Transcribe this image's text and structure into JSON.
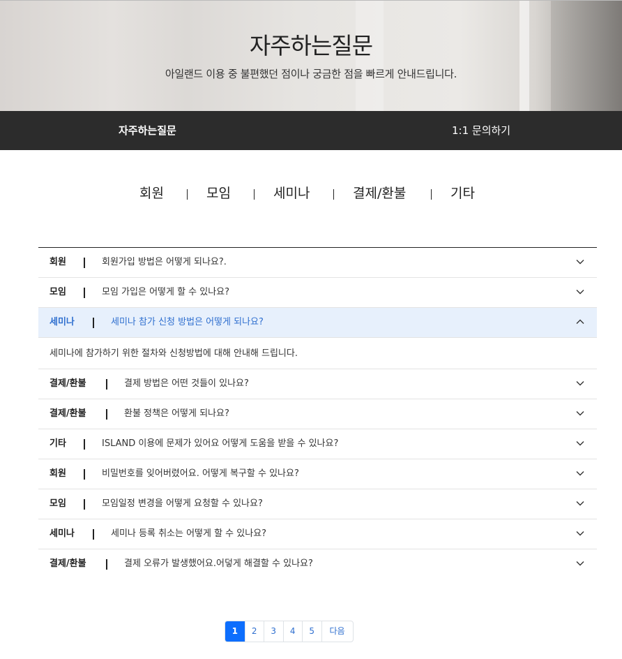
{
  "hero": {
    "title": "자주하는질문",
    "subtitle": "아일랜드 이용 중 불편했던 점이나 궁금한 점을 빠르게 안내드립니다."
  },
  "nav": {
    "tabs": [
      {
        "label": "자주하는질문",
        "active": true
      },
      {
        "label": "1:1 문의하기",
        "active": false
      }
    ]
  },
  "categories": [
    "회원",
    "모임",
    "세미나",
    "결제/환불",
    "기타"
  ],
  "faqs": [
    {
      "category": "회원",
      "question": "회원가입 방법은 어떻게 되나요?.",
      "expanded": false
    },
    {
      "category": "모임",
      "question": "모임 가입은 어떻게 할 수 있나요?",
      "expanded": false
    },
    {
      "category": "세미나",
      "question": "세미나 참가 신청 방법은 어떻게 되나요?",
      "expanded": true,
      "answer": "세미나에 참가하기 위한 절차와 신청방법에 대해 안내해 드립니다."
    },
    {
      "category": "결제/환불",
      "question": "결제 방법은 어떤 것들이 있나요?",
      "expanded": false
    },
    {
      "category": "결제/환불",
      "question": "환불 정책은 어떻게 되나요?",
      "expanded": false
    },
    {
      "category": "기타",
      "question": "ISLAND 이용에 문제가 있어요 어떻게 도움을 받을 수 있나요?",
      "expanded": false
    },
    {
      "category": "회원",
      "question": "비밀번호를 잊어버렸어요. 어떻게 복구할 수 있나요?",
      "expanded": false
    },
    {
      "category": "모임",
      "question": "모임일정 변경을 어떻게 요청할 수 있나요?",
      "expanded": false
    },
    {
      "category": "세미나",
      "question": "세미나 등록 취소는 어떻게 할 수 있나요?",
      "expanded": false
    },
    {
      "category": "결제/환불",
      "question": "결제 오류가 발생했어요.어덯게 해결할 수 있나요?",
      "expanded": false
    }
  ],
  "pagination": {
    "pages": [
      "1",
      "2",
      "3",
      "4",
      "5"
    ],
    "current": "1",
    "next_label": "다음"
  },
  "colors": {
    "nav_bg": "#2c2c2c",
    "active_row_bg": "#e7f0fc",
    "active_text": "#2f6fcf",
    "page_current_bg": "#0d6efd"
  },
  "icons": {
    "collapsed": "chevron-down-icon",
    "expanded": "chevron-up-icon"
  }
}
